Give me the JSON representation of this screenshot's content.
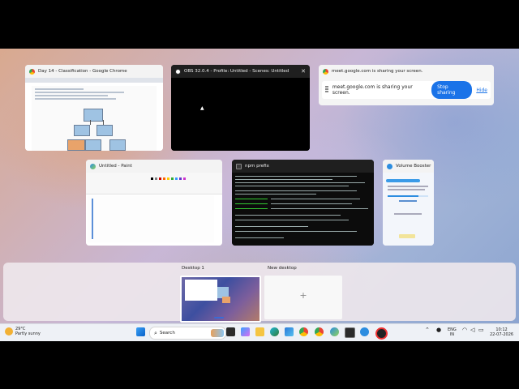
{
  "windows": {
    "chrome": {
      "title": "Day 14 - Classification - Google Chrome",
      "icon": "chrome-icon"
    },
    "obs": {
      "title": "OBS 32.0.4 - Profile: Untitled - Scenes: Untitled",
      "icon": "obs-icon"
    },
    "share": {
      "title": "meet.google.com is sharing your screen.",
      "message": "meet.google.com is sharing your screen.",
      "stop_label": "Stop sharing",
      "hide_label": "Hide"
    },
    "paint": {
      "title": "Untitled - Paint",
      "icon": "paint-icon"
    },
    "terminal": {
      "title": "npm prefix",
      "icon": "terminal-icon"
    },
    "volume": {
      "title": "Volume Booster",
      "icon": "volume-booster-icon"
    }
  },
  "desktops": {
    "items": [
      {
        "label": "Desktop 1"
      },
      {
        "label": "New desktop"
      }
    ]
  },
  "taskbar": {
    "weather_temp": "29°C",
    "weather_desc": "Partly sunny",
    "search_placeholder": "Search",
    "lang_top": "ENG",
    "lang_bottom": "IN",
    "time": "10:12",
    "date": "22-07-2026"
  },
  "colors": {
    "accent": "#1a73e8",
    "obs_bg": "#000000",
    "terminal_bg": "#0c0c0c"
  }
}
